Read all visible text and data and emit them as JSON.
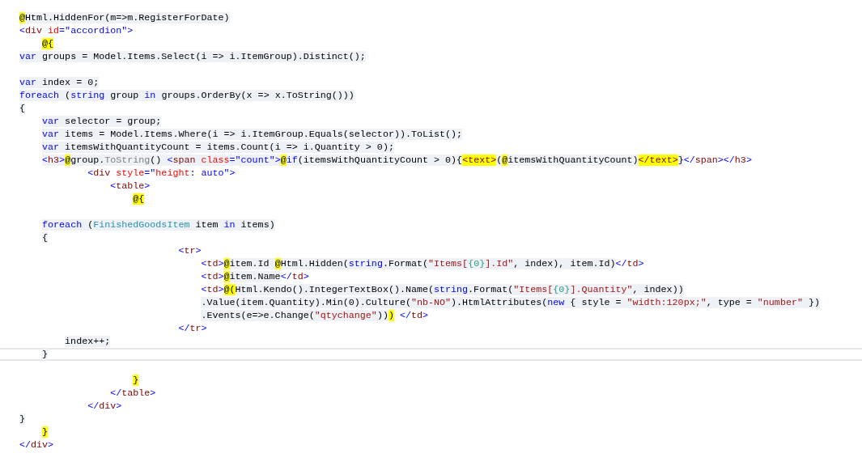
{
  "lines": [
    {
      "current": false,
      "runs": [
        {
          "code": true,
          "tokens": [
            {
              "text": "@",
              "kind": "razor"
            },
            {
              "text": "Html.HiddenFor(m=>m.RegisterForDate)",
              "kind": "plain"
            }
          ]
        }
      ]
    },
    {
      "current": false,
      "runs": [
        {
          "code": false,
          "tokens": [
            {
              "text": "<",
              "kind": "markup"
            },
            {
              "text": "div",
              "kind": "tag"
            },
            {
              "text": " id",
              "kind": "attr"
            },
            {
              "text": "=\"accordion\">",
              "kind": "markup"
            }
          ]
        }
      ]
    },
    {
      "current": false,
      "runs": [
        {
          "tokens": [
            {
              "text": "    @{",
              "kind": "razor"
            }
          ]
        }
      ]
    },
    {
      "current": false,
      "runs": [
        {
          "code": true,
          "tokens": [
            {
              "text": "var",
              "kind": "keyword"
            },
            {
              "text": " groups = Model.Items.Select(i => i.ItemGroup).Distinct();",
              "kind": "plain"
            }
          ]
        }
      ]
    },
    {
      "current": false
    },
    {
      "current": false,
      "runs": [
        {
          "code": true,
          "tokens": [
            {
              "text": "var",
              "kind": "keyword"
            },
            {
              "text": " index = 0;",
              "kind": "plain"
            }
          ]
        }
      ]
    },
    {
      "current": false,
      "runs": [
        {
          "code": true,
          "tokens": [
            {
              "text": "foreach",
              "kind": "keyword"
            },
            {
              "text": " (",
              "kind": "plain"
            },
            {
              "text": "string",
              "kind": "keyword"
            },
            {
              "text": " group ",
              "kind": "plain"
            },
            {
              "text": "in",
              "kind": "keyword"
            },
            {
              "text": " groups.OrderBy(x => x.ToString()))",
              "kind": "plain"
            }
          ]
        }
      ]
    },
    {
      "current": false,
      "runs": [
        {
          "code": true,
          "tokens": [
            {
              "text": "{",
              "kind": "plain"
            }
          ]
        }
      ]
    },
    {
      "current": false,
      "runs": [
        {
          "code": true,
          "tokens": [
            {
              "text": "    var",
              "kind": "keyword"
            },
            {
              "text": " selector = group;",
              "kind": "plain"
            }
          ]
        }
      ]
    },
    {
      "current": false,
      "runs": [
        {
          "code": true,
          "tokens": [
            {
              "text": "    var",
              "kind": "keyword"
            },
            {
              "text": " items = Model.Items.Where(i => i.ItemGroup.Equals(selector)).ToList();",
              "kind": "plain"
            }
          ]
        }
      ]
    },
    {
      "current": false,
      "runs": [
        {
          "code": true,
          "tokens": [
            {
              "text": "    var",
              "kind": "keyword"
            },
            {
              "text": " itemsWithQuantityCount = items.Count(i => i.Quantity > 0);",
              "kind": "plain"
            }
          ]
        }
      ]
    },
    {
      "current": false,
      "runs": [
        {
          "code": true,
          "tokens": [
            {
              "text": "    <",
              "kind": "markup"
            },
            {
              "text": "h3",
              "kind": "tag"
            },
            {
              "text": ">",
              "kind": "markup"
            },
            {
              "text": "@",
              "kind": "razor"
            },
            {
              "text": "group.",
              "kind": "plain"
            },
            {
              "text": "ToString",
              "kind": "muted"
            },
            {
              "text": "() ",
              "kind": "plain"
            },
            {
              "text": "<",
              "kind": "markup"
            },
            {
              "text": "span",
              "kind": "tag"
            },
            {
              "text": " class",
              "kind": "attr"
            },
            {
              "text": "=\"count\">",
              "kind": "markup"
            },
            {
              "text": "@",
              "kind": "razor"
            },
            {
              "text": "if",
              "kind": "keyword"
            },
            {
              "text": "(itemsWithQuantityCount > 0){",
              "kind": "plain"
            },
            {
              "text": "<text>",
              "kind": "razor-tag"
            },
            {
              "text": "(",
              "kind": "plain"
            },
            {
              "text": "@",
              "kind": "razor"
            },
            {
              "text": "itemsWithQuantityCount)",
              "kind": "plain"
            },
            {
              "text": "</text>",
              "kind": "razor-tag"
            },
            {
              "text": "}",
              "kind": "plain"
            }
          ]
        },
        {
          "code": false,
          "tokens": [
            {
              "text": "</",
              "kind": "markup"
            },
            {
              "text": "span",
              "kind": "tag"
            },
            {
              "text": "></",
              "kind": "markup"
            },
            {
              "text": "h3",
              "kind": "tag"
            },
            {
              "text": ">",
              "kind": "markup"
            }
          ]
        }
      ]
    },
    {
      "current": false,
      "runs": [
        {
          "code": false,
          "tokens": [
            {
              "text": "            <",
              "kind": "markup"
            },
            {
              "text": "div",
              "kind": "tag"
            },
            {
              "text": " style",
              "kind": "attr"
            },
            {
              "text": "=\"",
              "kind": "markup"
            },
            {
              "text": "height",
              "kind": "attr"
            },
            {
              "text": ": ",
              "kind": "plain"
            },
            {
              "text": "auto\">",
              "kind": "markup"
            }
          ]
        }
      ]
    },
    {
      "current": false,
      "runs": [
        {
          "code": false,
          "tokens": [
            {
              "text": "                <",
              "kind": "markup"
            },
            {
              "text": "table",
              "kind": "tag"
            },
            {
              "text": ">",
              "kind": "markup"
            }
          ]
        }
      ]
    },
    {
      "current": false,
      "runs": [
        {
          "tokens": [
            {
              "text": "                    @{",
              "kind": "razor"
            }
          ]
        }
      ]
    },
    {
      "current": false
    },
    {
      "current": false,
      "runs": [
        {
          "code": true,
          "tokens": [
            {
              "text": "    foreach",
              "kind": "keyword"
            },
            {
              "text": " (",
              "kind": "plain"
            },
            {
              "text": "FinishedGoodsItem",
              "kind": "type"
            },
            {
              "text": " item ",
              "kind": "plain"
            },
            {
              "text": "in",
              "kind": "keyword"
            },
            {
              "text": " items)",
              "kind": "plain"
            }
          ]
        }
      ]
    },
    {
      "current": false,
      "runs": [
        {
          "code": true,
          "tokens": [
            {
              "text": "    {",
              "kind": "plain"
            }
          ]
        }
      ]
    },
    {
      "current": false,
      "runs": [
        {
          "code": false,
          "tokens": [
            {
              "text": "                            <",
              "kind": "markup"
            },
            {
              "text": "tr",
              "kind": "tag"
            },
            {
              "text": ">",
              "kind": "markup"
            }
          ]
        }
      ]
    },
    {
      "current": false,
      "runs": [
        {
          "code": false,
          "tokens": [
            {
              "text": "                                <",
              "kind": "markup"
            },
            {
              "text": "td",
              "kind": "tag"
            },
            {
              "text": ">",
              "kind": "markup"
            }
          ]
        },
        {
          "code": true,
          "tokens": [
            {
              "text": "@",
              "kind": "razor"
            },
            {
              "text": "item.Id ",
              "kind": "plain"
            },
            {
              "text": "@",
              "kind": "razor"
            },
            {
              "text": "Html.Hidden(",
              "kind": "plain"
            },
            {
              "text": "string",
              "kind": "keyword"
            },
            {
              "text": ".Format(",
              "kind": "plain"
            },
            {
              "text": "\"Items[",
              "kind": "string"
            },
            {
              "text": "{0}",
              "kind": "format"
            },
            {
              "text": "].Id\"",
              "kind": "string"
            },
            {
              "text": ", index), item.Id)",
              "kind": "plain"
            }
          ]
        },
        {
          "code": false,
          "tokens": [
            {
              "text": "</",
              "kind": "markup"
            },
            {
              "text": "td",
              "kind": "tag"
            },
            {
              "text": ">",
              "kind": "markup"
            }
          ]
        }
      ]
    },
    {
      "current": false,
      "runs": [
        {
          "code": false,
          "tokens": [
            {
              "text": "                                <",
              "kind": "markup"
            },
            {
              "text": "td",
              "kind": "tag"
            },
            {
              "text": ">",
              "kind": "markup"
            }
          ]
        },
        {
          "code": true,
          "tokens": [
            {
              "text": "@",
              "kind": "razor"
            },
            {
              "text": "item.Name",
              "kind": "plain"
            }
          ]
        },
        {
          "code": false,
          "tokens": [
            {
              "text": "</",
              "kind": "markup"
            },
            {
              "text": "td",
              "kind": "tag"
            },
            {
              "text": ">",
              "kind": "markup"
            }
          ]
        }
      ]
    },
    {
      "current": false,
      "runs": [
        {
          "code": false,
          "tokens": [
            {
              "text": "                                <",
              "kind": "markup"
            },
            {
              "text": "td",
              "kind": "tag"
            },
            {
              "text": ">",
              "kind": "markup"
            }
          ]
        },
        {
          "code": true,
          "tokens": [
            {
              "text": "@(",
              "kind": "razor"
            },
            {
              "text": "Html.Kendo().IntegerTextBox().Name(",
              "kind": "plain"
            },
            {
              "text": "string",
              "kind": "keyword"
            },
            {
              "text": ".Format(",
              "kind": "plain"
            },
            {
              "text": "\"Items[",
              "kind": "string"
            },
            {
              "text": "{0}",
              "kind": "format"
            },
            {
              "text": "].Quantity\"",
              "kind": "string"
            },
            {
              "text": ", index))",
              "kind": "plain"
            }
          ]
        }
      ]
    },
    {
      "current": false,
      "runs": [
        {
          "code": true,
          "tokens": [
            {
              "text": "                                .Value(item.Quantity).Min(0).Culture(",
              "kind": "plain"
            },
            {
              "text": "\"nb-NO\"",
              "kind": "string"
            },
            {
              "text": ").HtmlAttributes(",
              "kind": "plain"
            },
            {
              "text": "new",
              "kind": "keyword"
            },
            {
              "text": " { style = ",
              "kind": "plain"
            },
            {
              "text": "\"width:120px;\"",
              "kind": "string"
            },
            {
              "text": ", type = ",
              "kind": "plain"
            },
            {
              "text": "\"number\"",
              "kind": "string"
            },
            {
              "text": " })",
              "kind": "plain"
            }
          ]
        }
      ]
    },
    {
      "current": false,
      "runs": [
        {
          "code": true,
          "tokens": [
            {
              "text": "                                .Events(e=>e.Change(",
              "kind": "plain"
            },
            {
              "text": "\"qtychange\"",
              "kind": "string"
            },
            {
              "text": "))",
              "kind": "plain"
            },
            {
              "text": ")",
              "kind": "razor"
            }
          ]
        },
        {
          "code": false,
          "tokens": [
            {
              "text": " </",
              "kind": "markup"
            },
            {
              "text": "td",
              "kind": "tag"
            },
            {
              "text": ">",
              "kind": "markup"
            }
          ]
        }
      ]
    },
    {
      "current": false,
      "runs": [
        {
          "code": false,
          "tokens": [
            {
              "text": "                            </",
              "kind": "markup"
            },
            {
              "text": "tr",
              "kind": "tag"
            },
            {
              "text": ">",
              "kind": "markup"
            }
          ]
        }
      ]
    },
    {
      "current": false,
      "runs": [
        {
          "code": true,
          "tokens": [
            {
              "text": "        index++;",
              "kind": "plain"
            }
          ]
        }
      ]
    },
    {
      "current": true,
      "runs": [
        {
          "code": true,
          "tokens": [
            {
              "text": "    }",
              "kind": "plain"
            }
          ]
        }
      ]
    },
    {
      "current": false
    },
    {
      "current": false,
      "runs": [
        {
          "tokens": [
            {
              "text": "                    }",
              "kind": "razor"
            }
          ]
        }
      ]
    },
    {
      "current": false,
      "runs": [
        {
          "code": false,
          "tokens": [
            {
              "text": "                </",
              "kind": "markup"
            },
            {
              "text": "table",
              "kind": "tag"
            },
            {
              "text": ">",
              "kind": "markup"
            }
          ]
        }
      ]
    },
    {
      "current": false,
      "runs": [
        {
          "code": false,
          "tokens": [
            {
              "text": "            </",
              "kind": "markup"
            },
            {
              "text": "div",
              "kind": "tag"
            },
            {
              "text": ">",
              "kind": "markup"
            }
          ]
        }
      ]
    },
    {
      "current": false,
      "runs": [
        {
          "code": true,
          "tokens": [
            {
              "text": "}",
              "kind": "plain"
            }
          ]
        }
      ]
    },
    {
      "current": false,
      "runs": [
        {
          "tokens": [
            {
              "text": "    }",
              "kind": "razor"
            }
          ]
        }
      ]
    },
    {
      "current": false,
      "runs": [
        {
          "code": false,
          "tokens": [
            {
              "text": "</",
              "kind": "markup"
            },
            {
              "text": "div",
              "kind": "tag"
            },
            {
              "text": ">",
              "kind": "markup"
            }
          ]
        }
      ]
    }
  ]
}
